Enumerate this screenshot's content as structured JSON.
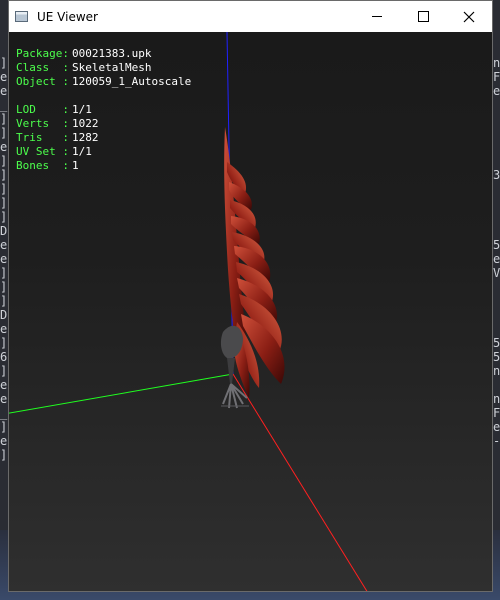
{
  "window": {
    "title": "UE Viewer"
  },
  "info": {
    "package_label": "Package:",
    "package_value": "00021383.upk",
    "class_label": "Class  :",
    "class_value": "SkeletalMesh",
    "object_label": "Object :",
    "object_value": "120059_1_Autoscale",
    "lod_label": "LOD    :",
    "lod_value": "1/1",
    "verts_label": "Verts  :",
    "verts_value": "1022",
    "tris_label": "Tris   :",
    "tris_value": "1282",
    "uvset_label": "UV Set :",
    "uvset_value": "1/1",
    "bones_label": "Bones  :",
    "bones_value": "1"
  },
  "background_console": {
    "left_chars": [
      "]",
      "e",
      "e",
      "_",
      "]",
      "]",
      "e",
      "]",
      "]",
      "]",
      "]",
      "]",
      "D",
      "e",
      "e",
      "]",
      "]",
      "]",
      "D",
      "e",
      "]",
      "6",
      "]",
      "e",
      "e",
      "_",
      "]",
      "e",
      "]"
    ],
    "right_chars": [
      "n",
      "F",
      "e",
      "",
      "",
      "",
      "",
      "",
      "3",
      "",
      "",
      "",
      "",
      "5",
      "e",
      "V",
      "",
      "",
      "",
      "",
      "5",
      "5",
      "n",
      "",
      "n",
      "F",
      "e",
      "-",
      "",
      ""
    ]
  },
  "colors": {
    "axis_x": "#ff2020",
    "axis_y": "#20ff20",
    "axis_z": "#2020ff",
    "label_green": "#4cff4c",
    "value_white": "#ffffff"
  }
}
